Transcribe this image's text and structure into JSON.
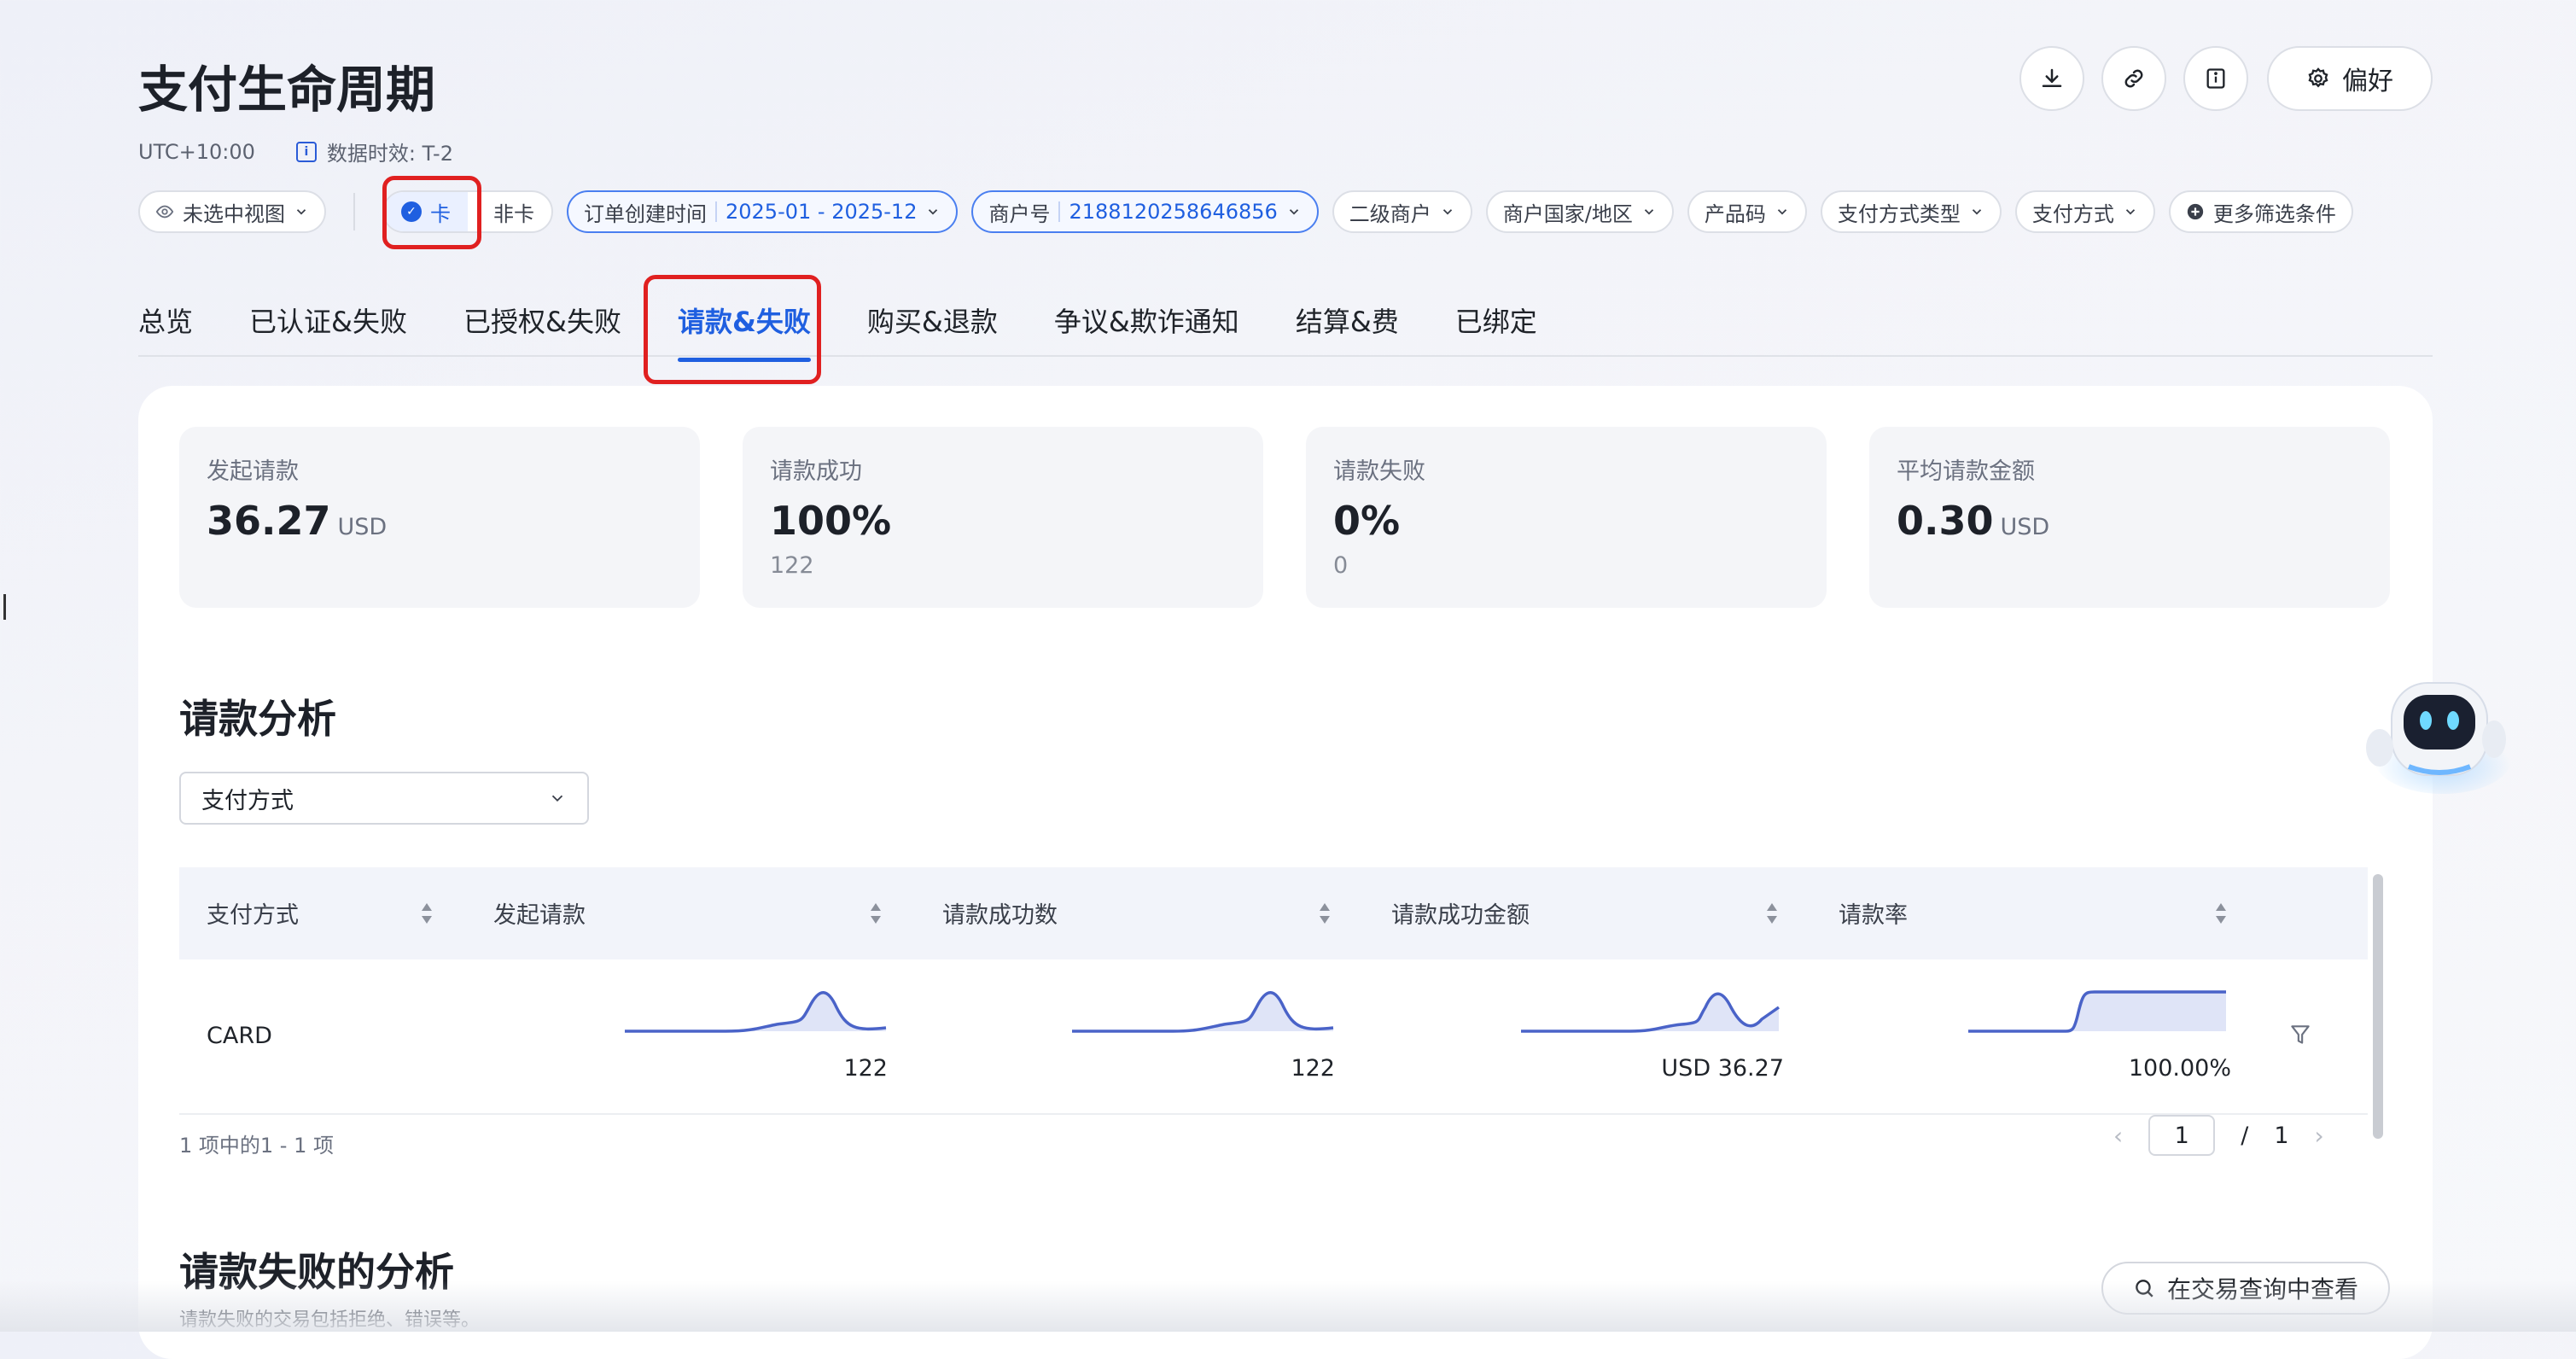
{
  "header": {
    "title": "支付生命周期",
    "timezone": "UTC+10:00",
    "data_freshness": "数据时效: T-2",
    "preference_label": "偏好"
  },
  "filters": {
    "view": "未选中视图",
    "card": "卡",
    "noncard": "非卡",
    "order_time_label": "订单创建时间",
    "order_time_value": "2025-01 - 2025-12",
    "merchant_label": "商户号",
    "merchant_value": "2188120258646856",
    "sub_merchant": "二级商户",
    "merchant_country": "商户国家/地区",
    "product_code": "产品码",
    "payment_method_type": "支付方式类型",
    "payment_method": "支付方式",
    "more_filters": "更多筛选条件"
  },
  "tabs": [
    {
      "label": "总览",
      "active": false
    },
    {
      "label": "已认证&失败",
      "active": false
    },
    {
      "label": "已授权&失败",
      "active": false
    },
    {
      "label": "请款&失败",
      "active": true
    },
    {
      "label": "购买&退款",
      "active": false
    },
    {
      "label": "争议&欺诈通知",
      "active": false
    },
    {
      "label": "结算&费",
      "active": false
    },
    {
      "label": "已绑定",
      "active": false
    }
  ],
  "kpis": [
    {
      "label": "发起请款",
      "value": "36.27",
      "unit": "USD",
      "sub": ""
    },
    {
      "label": "请款成功",
      "value": "100%",
      "unit": "",
      "sub": "122"
    },
    {
      "label": "请款失败",
      "value": "0%",
      "unit": "",
      "sub": "0"
    },
    {
      "label": "平均请款金额",
      "value": "0.30",
      "unit": "USD",
      "sub": ""
    }
  ],
  "analysis": {
    "title": "请款分析",
    "dimension_select": "支付方式",
    "columns": [
      "支付方式",
      "发起请款",
      "请款成功数",
      "请款成功金额",
      "请款率"
    ],
    "rows": [
      {
        "method": "CARD",
        "initiated": "122",
        "success_count": "122",
        "success_amount": "USD 36.27",
        "rate": "100.00%"
      }
    ],
    "pagination_info": "1 项中的1 - 1 项",
    "current_page": "1",
    "page_sep": "/",
    "total_pages": "1"
  },
  "failure_analysis": {
    "title": "请款失败的分析",
    "description": "请款失败的交易包括拒绝、错误等。",
    "view_in_query_button": "在交易查询中查看"
  },
  "colors": {
    "accent": "#1f5fe0",
    "highlight_box": "#e02020",
    "sparkline": "#4a63c8"
  }
}
